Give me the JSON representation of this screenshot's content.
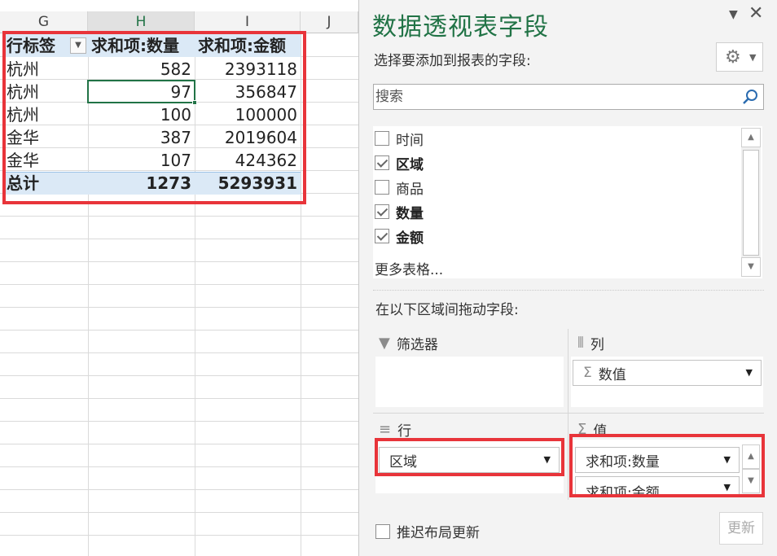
{
  "sheet": {
    "columns": [
      "G",
      "H",
      "I",
      "J"
    ],
    "pivot": {
      "headers": [
        "行标签",
        "求和项:数量",
        "求和项:金额"
      ],
      "rows": [
        {
          "label": "杭州",
          "qty": "582",
          "amount": "2393118"
        },
        {
          "label": "杭州",
          "qty": "97",
          "amount": "356847"
        },
        {
          "label": "杭州",
          "qty": "100",
          "amount": "100000"
        },
        {
          "label": "金华",
          "qty": "387",
          "amount": "2019604"
        },
        {
          "label": "金华",
          "qty": "107",
          "amount": "424362"
        }
      ],
      "total": {
        "label": "总计",
        "qty": "1273",
        "amount": "5293931"
      }
    }
  },
  "panel": {
    "title": "数据透视表字段",
    "subtitle": "选择要添加到报表的字段:",
    "search_placeholder": "搜索",
    "fields": [
      {
        "label": "时间",
        "checked": false
      },
      {
        "label": "区域",
        "checked": true
      },
      {
        "label": "商品",
        "checked": false
      },
      {
        "label": "数量",
        "checked": true
      },
      {
        "label": "金额",
        "checked": true
      }
    ],
    "more_tables": "更多表格...",
    "drag_label": "在以下区域间拖动字段:",
    "areas": {
      "filter": {
        "title": "筛选器",
        "icon": "filter-icon"
      },
      "columns": {
        "title": "列",
        "icon": "columns-icon",
        "items": [
          "数值"
        ]
      },
      "rows": {
        "title": "行",
        "icon": "rows-icon",
        "items": [
          "区域"
        ]
      },
      "values": {
        "title": "值",
        "icon": "sigma-icon",
        "items": [
          "求和项:数量",
          "求和项:金额"
        ]
      }
    },
    "defer_label": "推迟布局更新",
    "update_label": "更新",
    "colors": {
      "accent": "#217346",
      "highlight": "#e8343a",
      "pivot_header": "#dbe9f6"
    }
  }
}
